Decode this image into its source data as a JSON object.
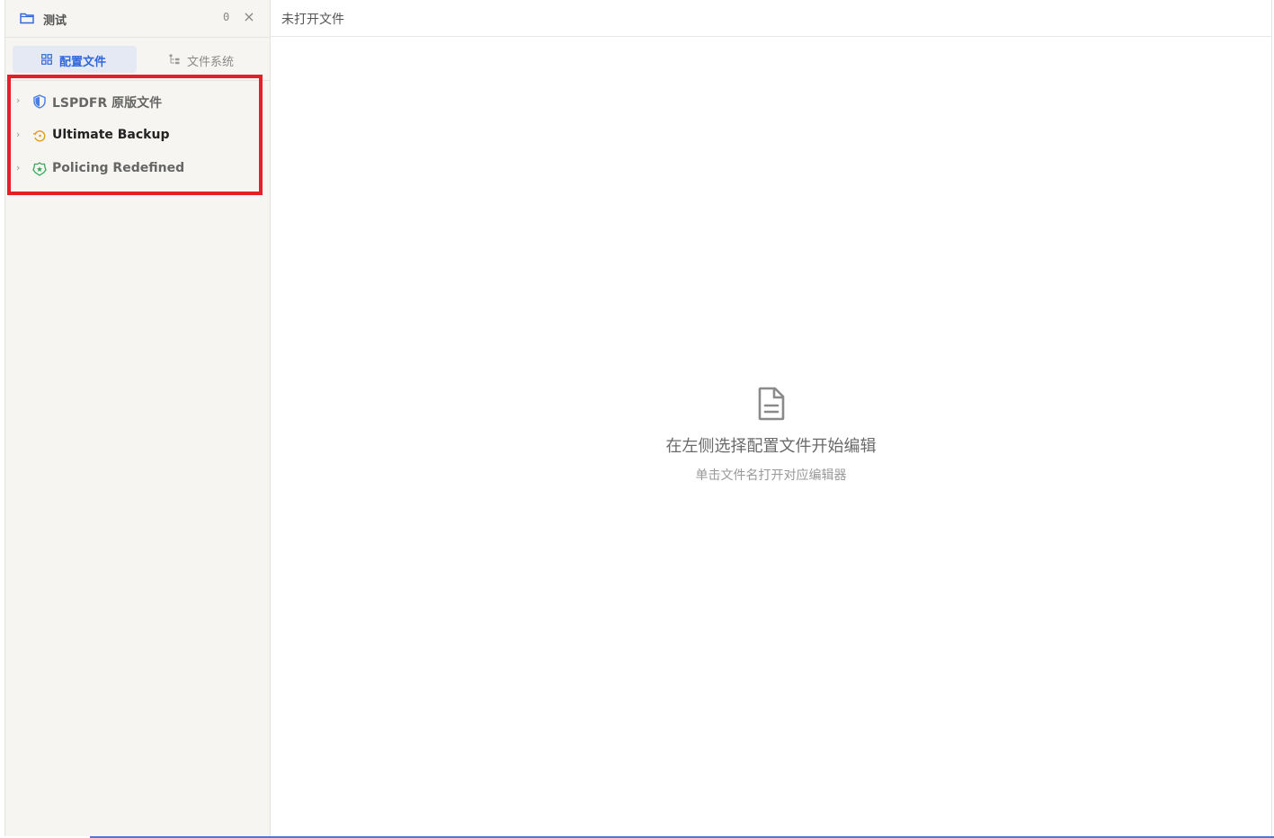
{
  "sidebar": {
    "project_title": "测试",
    "project_count": "0",
    "close_symbol": "×",
    "tabs": [
      {
        "label": "配置文件",
        "icon": "grid-icon",
        "active": true
      },
      {
        "label": "文件系统",
        "icon": "tree-icon",
        "active": false
      }
    ],
    "items": [
      {
        "label": "LSPDFR 原版文件",
        "icon": "shield-icon",
        "color": "#4a7fe0"
      },
      {
        "label": "Ultimate Backup",
        "icon": "restore-icon",
        "color": "#e39b1c"
      },
      {
        "label": "Policing Redefined",
        "icon": "police-badge-icon",
        "color": "#35a957"
      }
    ]
  },
  "main": {
    "title": "未打开文件",
    "empty_title": "在左侧选择配置文件开始编辑",
    "empty_subtitle": "单击文件名打开对应编辑器"
  },
  "colors": {
    "accent": "#2f66d9",
    "highlight": "#e61f26"
  }
}
